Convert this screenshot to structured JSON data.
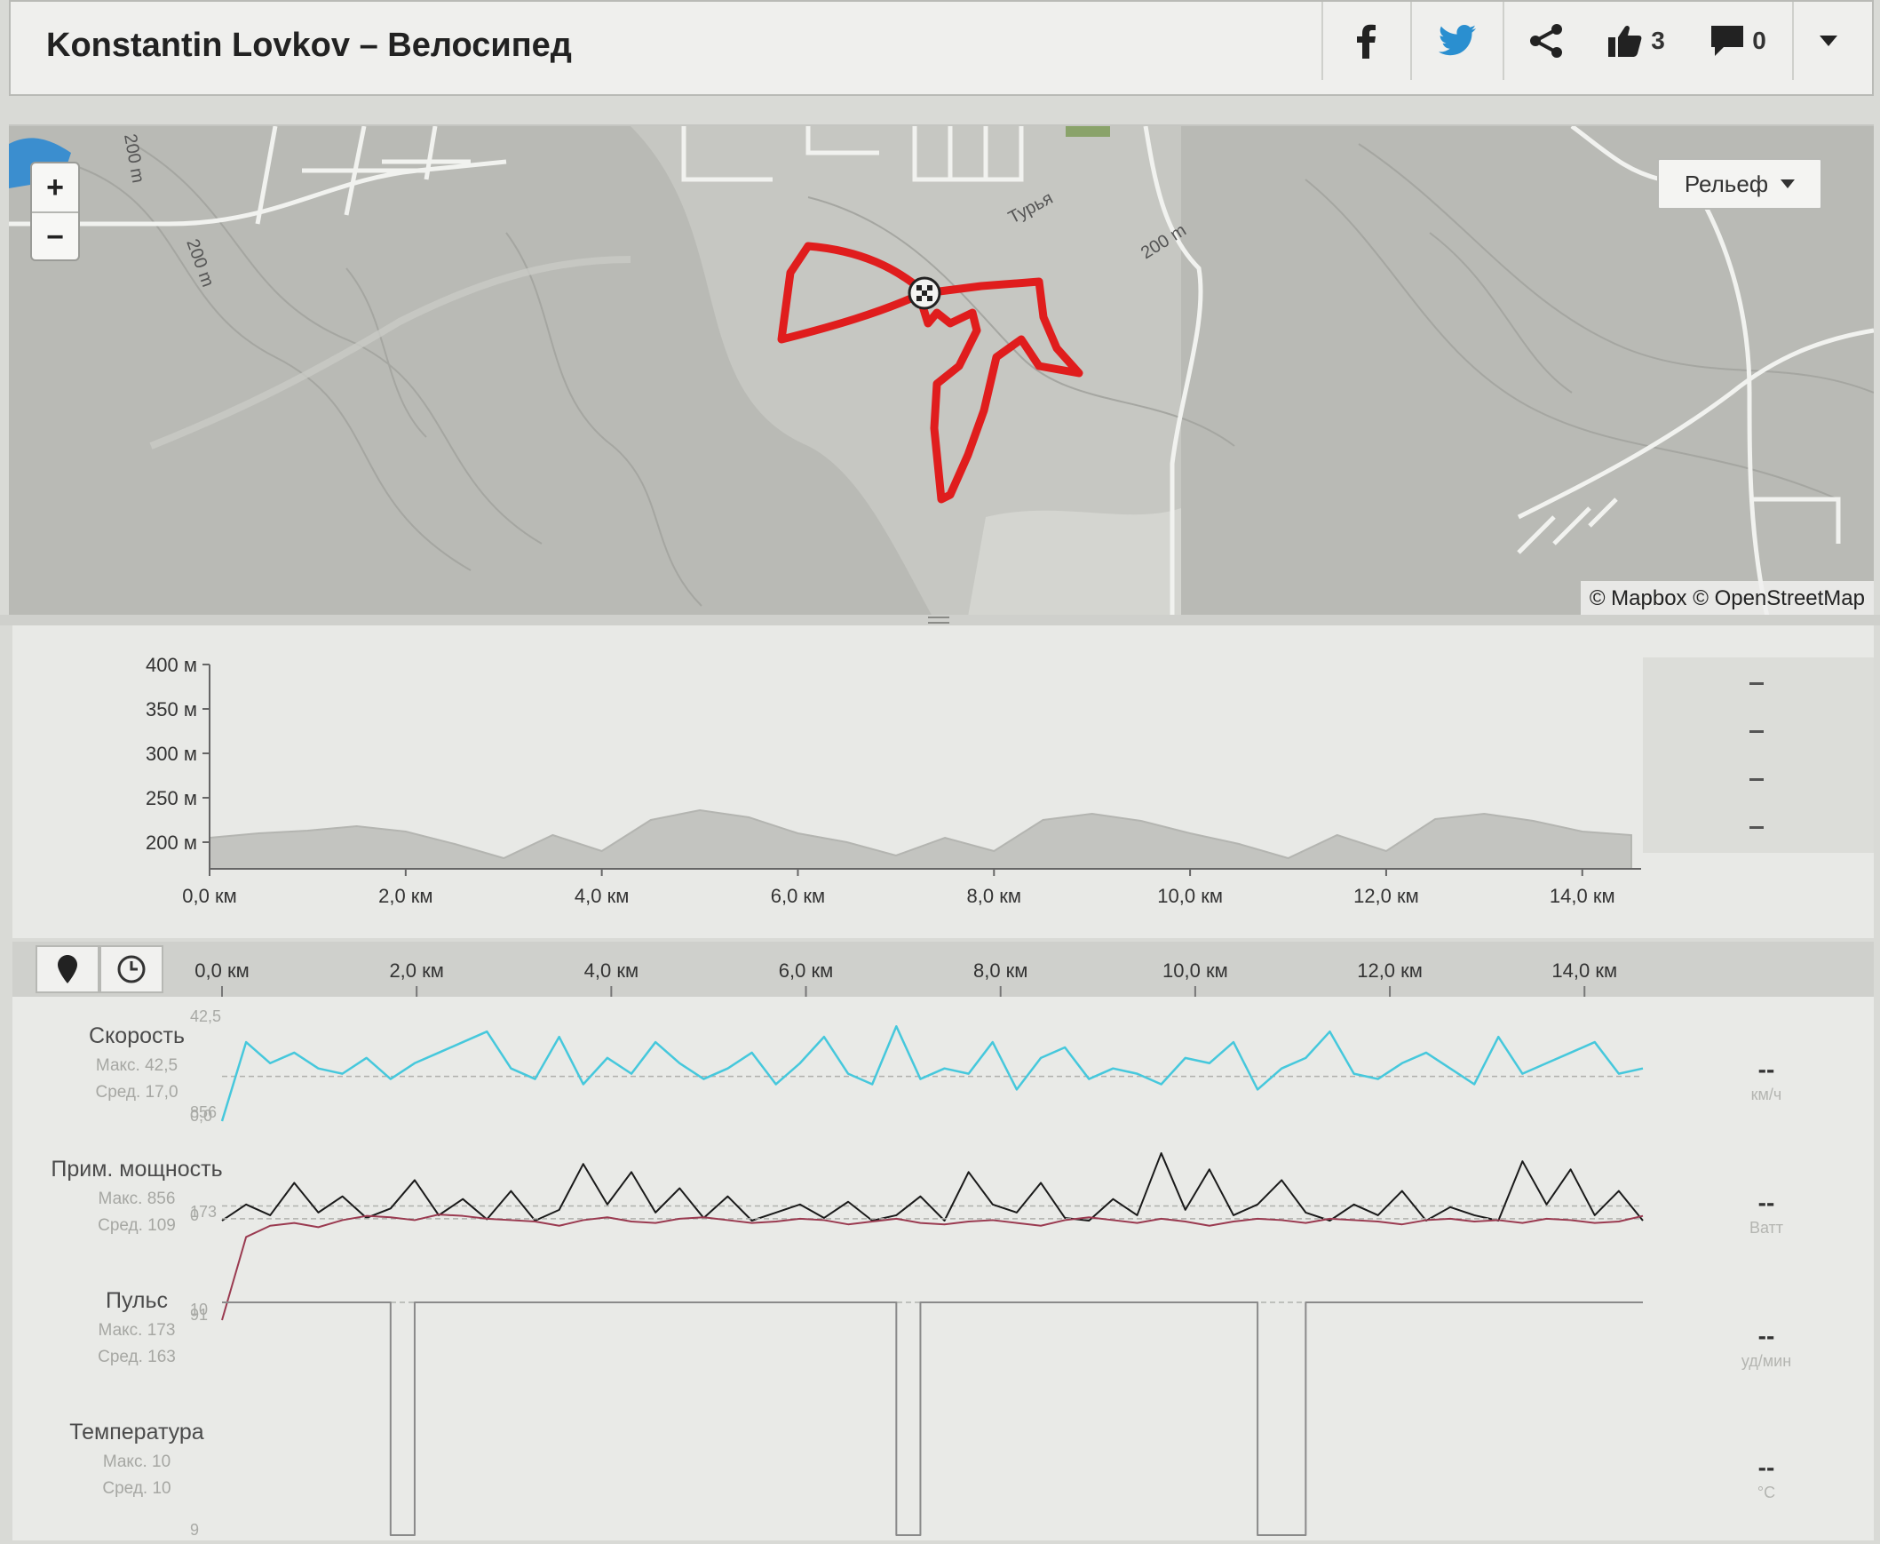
{
  "header": {
    "title": "Konstantin Lovkov – Велосипед",
    "likes": "3",
    "comments": "0"
  },
  "map": {
    "zoom_in": "+",
    "zoom_out": "−",
    "layer": "Рельеф",
    "attribution": "© Mapbox © OpenStreetMap",
    "labels": {
      "river": "Турья",
      "contour_a": "200 m",
      "contour_b": "200 m",
      "contour_c": "200 m"
    }
  },
  "chart_data": [
    {
      "type": "area",
      "series": [
        {
          "x": [
            0,
            0.5,
            1,
            1.5,
            2,
            2.5,
            3,
            3.5,
            4,
            4.5,
            5,
            5.5,
            6,
            6.5,
            7,
            7.5,
            8,
            8.5,
            9,
            9.5,
            10,
            10.5,
            11,
            11.5,
            12,
            12.5,
            13,
            13.5,
            14,
            14.5
          ],
          "values": [
            205,
            210,
            213,
            218,
            212,
            198,
            182,
            208,
            190,
            225,
            236,
            228,
            210,
            200,
            185,
            205,
            190,
            225,
            232,
            224,
            210,
            198,
            182,
            208,
            190,
            226,
            232,
            224,
            212,
            208
          ]
        }
      ],
      "y_ticks": [
        "200 м",
        "250 м",
        "300 м",
        "350 м",
        "400 м"
      ],
      "x_ticks": [
        "0,0 км",
        "2,0 км",
        "4,0 км",
        "6,0 км",
        "8,0 км",
        "10,0 км",
        "12,0 км",
        "14,0 км"
      ],
      "ylim": [
        170,
        400
      ],
      "xlim": [
        0,
        14.6
      ],
      "grid": false
    },
    {
      "type": "line",
      "x_ticks": [
        "0,0 км",
        "2,0 км",
        "4,0 км",
        "6,0 км",
        "8,0 км",
        "10,0 км",
        "12,0 км",
        "14,0 км"
      ],
      "xlim": [
        0,
        14.6
      ],
      "series": [
        {
          "name": "Скорость",
          "color": "#46c8dc",
          "ylim": [
            0,
            42.5
          ],
          "tick_labels": [
            "42,5",
            "0,0"
          ],
          "avg": 17.0,
          "values": [
            0,
            30,
            22,
            26,
            20,
            18,
            24,
            16,
            22,
            26,
            30,
            34,
            20,
            16,
            32,
            14,
            24,
            18,
            30,
            22,
            16,
            20,
            26,
            14,
            22,
            32,
            18,
            14,
            36,
            16,
            20,
            18,
            30,
            12,
            24,
            28,
            16,
            20,
            18,
            14,
            24,
            22,
            30,
            12,
            20,
            24,
            34,
            18,
            16,
            22,
            26,
            20,
            14,
            32,
            18,
            22,
            26,
            30,
            18,
            20
          ]
        },
        {
          "name": "Прим. мощность",
          "color": "#1a1a1a",
          "ylim": [
            0,
            856
          ],
          "tick_labels": [
            "856",
            "0"
          ],
          "avg": 109,
          "values": [
            0,
            120,
            40,
            280,
            60,
            180,
            20,
            90,
            300,
            40,
            160,
            10,
            220,
            0,
            80,
            420,
            120,
            360,
            60,
            240,
            20,
            180,
            0,
            60,
            120,
            20,
            140,
            0,
            40,
            180,
            0,
            360,
            120,
            60,
            280,
            20,
            0,
            160,
            40,
            500,
            80,
            380,
            40,
            120,
            300,
            60,
            0,
            120,
            40,
            220,
            0,
            100,
            40,
            0,
            440,
            120,
            380,
            40,
            220,
            0
          ]
        },
        {
          "name": "Пульс",
          "color": "#9a3a50",
          "ylim": [
            91,
            173
          ],
          "tick_labels": [
            "173",
            "91"
          ],
          "avg": 163,
          "values": [
            91,
            150,
            158,
            160,
            157,
            162,
            165,
            164,
            162,
            166,
            165,
            163,
            162,
            161,
            158,
            162,
            164,
            161,
            160,
            163,
            164,
            162,
            160,
            161,
            163,
            162,
            159,
            161,
            163,
            160,
            159,
            161,
            162,
            160,
            158,
            162,
            164,
            162,
            160,
            163,
            161,
            158,
            161,
            163,
            162,
            160,
            163,
            162,
            161,
            159,
            162,
            163,
            161,
            162,
            160,
            163,
            162,
            160,
            161,
            165
          ]
        },
        {
          "name": "Температура",
          "color": "#8a8a8a",
          "ylim": [
            9,
            10
          ],
          "tick_labels": [
            "10",
            "9"
          ],
          "avg": 10,
          "values": [
            10,
            10,
            10,
            10,
            10,
            10,
            10,
            9,
            10,
            10,
            10,
            10,
            10,
            10,
            10,
            10,
            10,
            10,
            10,
            10,
            10,
            10,
            10,
            10,
            10,
            10,
            10,
            10,
            9,
            10,
            10,
            10,
            10,
            10,
            10,
            10,
            10,
            10,
            10,
            10,
            10,
            10,
            10,
            9,
            9,
            10,
            10,
            10,
            10,
            10,
            10,
            10,
            10,
            10,
            10,
            10,
            10,
            10,
            10,
            10
          ]
        }
      ]
    }
  ],
  "toolbar": {
    "location_icon": "map-pin-icon",
    "time_icon": "clock-icon"
  },
  "metrics": [
    {
      "name": "Скорость",
      "max": "Макс. 42,5",
      "avg": "Сред. 17,0",
      "dash": "--",
      "unit": "км/ч"
    },
    {
      "name": "Прим. мощность",
      "max": "Макс. 856",
      "avg": "Сред. 109",
      "dash": "--",
      "unit": "Ватт"
    },
    {
      "name": "Пульс",
      "max": "Макс. 173",
      "avg": "Сред. 163",
      "dash": "--",
      "unit": "уд/мин"
    },
    {
      "name": "Температура",
      "max": "Макс. 10",
      "avg": "Сред. 10",
      "dash": "--",
      "unit": "°C"
    }
  ]
}
